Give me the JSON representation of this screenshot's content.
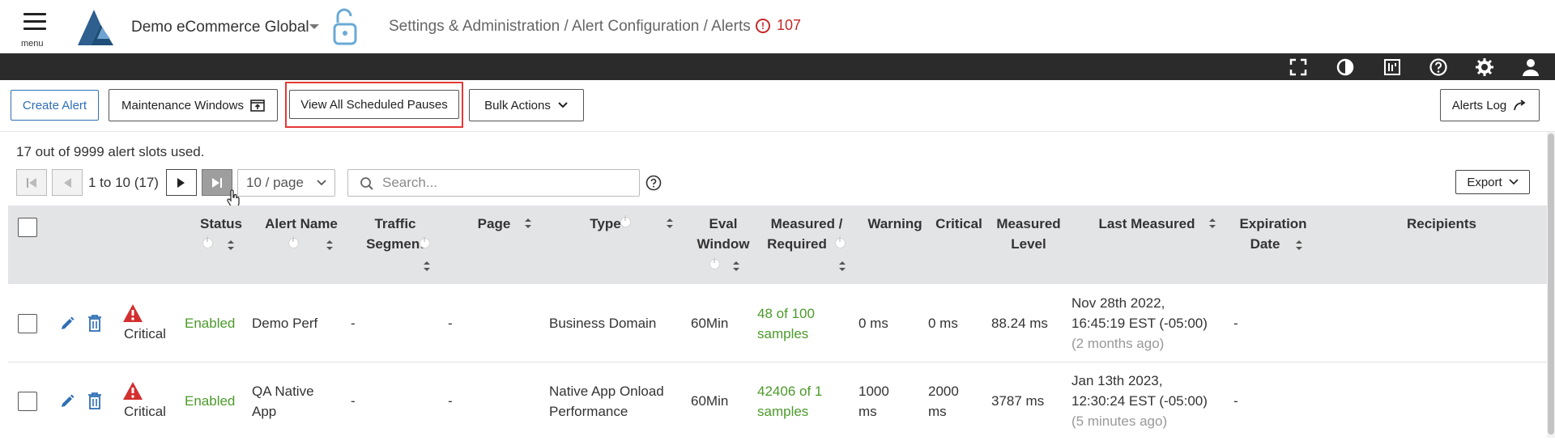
{
  "app": {
    "menu_label": "menu",
    "company": "Demo eCommerce Global",
    "breadcrumb": "Settings & Administration / Alert Configuration / Alerts",
    "alert_count": "107",
    "alert_icon": "!"
  },
  "darkbar_icons": [
    "fullscreen-icon",
    "contrast-icon",
    "report-icon",
    "help-icon",
    "gear-icon",
    "user-icon"
  ],
  "toolbar": {
    "create_alert": "Create Alert",
    "maintenance_windows": "Maintenance Windows",
    "view_scheduled_pauses": "View All Scheduled Pauses",
    "bulk_actions": "Bulk Actions",
    "alerts_log": "Alerts Log"
  },
  "list": {
    "slots_used": "17 out of 9999 alert slots used.",
    "range": "1 to 10 (17)",
    "per_page": "10 / page",
    "search_placeholder": "Search...",
    "export": "Export"
  },
  "columns": {
    "status": "Status",
    "alert_name": "Alert Name",
    "traffic_segment_1": "Traffic",
    "traffic_segment_2": "Segment",
    "page": "Page",
    "type": "Type",
    "eval_window_1": "Eval",
    "eval_window_2": "Window",
    "measured_required_1": "Measured /",
    "measured_required_2": "Required",
    "warning": "Warning",
    "critical": "Critical",
    "measured_level_1": "Measured",
    "measured_level_2": "Level",
    "last_measured": "Last Measured",
    "expiration_date_1": "Expiration",
    "expiration_date_2": "Date",
    "recipients": "Recipients"
  },
  "rows": [
    {
      "severity": "Critical",
      "status": "Enabled",
      "alert_name": "Demo Perf",
      "alert_name_2": "",
      "traffic_segment": "-",
      "page": "-",
      "type_1": "Business Domain",
      "type_2": "",
      "eval_window": "60Min",
      "measured_1": "48 of 100",
      "measured_2": "samples",
      "warning_1": "0 ms",
      "warning_2": "",
      "critical_1": "0 ms",
      "critical_2": "",
      "measured_level": "88.24 ms",
      "last_measured_1": "Nov 28th 2022,",
      "last_measured_2": "16:45:19 EST (-05:00)",
      "last_measured_ago": "(2 months ago)",
      "expiration": "-"
    },
    {
      "severity": "Critical",
      "status": "Enabled",
      "alert_name": "QA Native",
      "alert_name_2": "App",
      "traffic_segment": "-",
      "page": "-",
      "type_1": "Native App Onload",
      "type_2": "Performance",
      "eval_window": "60Min",
      "measured_1": "42406 of 1",
      "measured_2": "samples",
      "warning_1": "1000",
      "warning_2": "ms",
      "critical_1": "2000",
      "critical_2": "ms",
      "measured_level": "3787 ms",
      "last_measured_1": "Jan 13th 2023,",
      "last_measured_2": "12:30:24 EST (-05:00)",
      "last_measured_ago": "(5 minutes ago)",
      "expiration": "-"
    }
  ],
  "colors": {
    "accent_blue": "#2f6fb3",
    "enabled_green": "#4c9a2a",
    "critical_red": "#d32f2f",
    "header_dark": "#2b2b2b",
    "highlight_red": "#e53935"
  }
}
